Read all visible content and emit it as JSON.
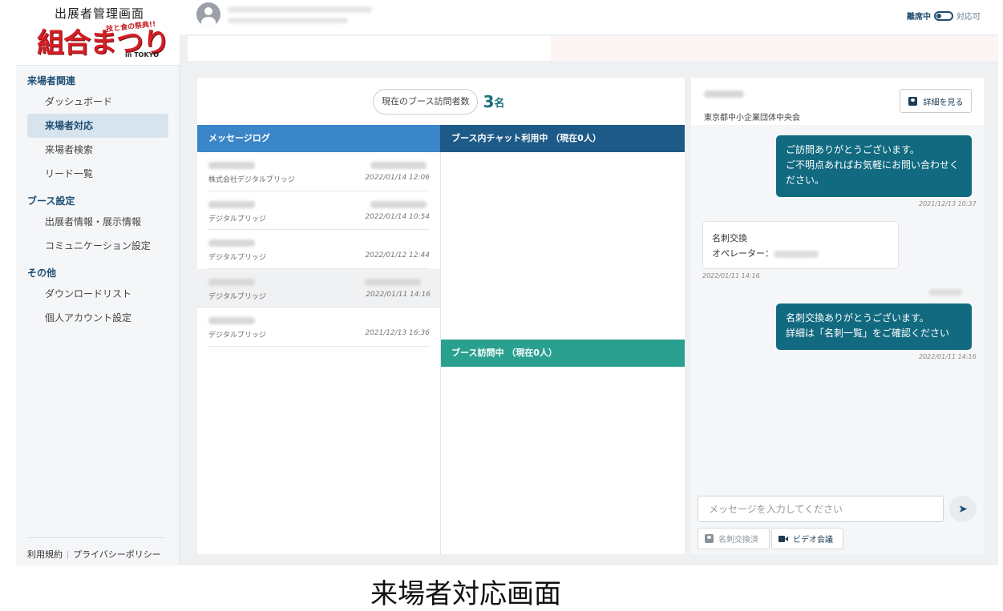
{
  "logo": {
    "title": "出展者管理画面",
    "main": "組合まつり",
    "sub": "技と食の祭典!!",
    "location": "in TOKYO"
  },
  "sidebar": {
    "sections": [
      {
        "label": "来場者関連",
        "items": [
          "ダッシュボード",
          "来場者対応",
          "来場者検索",
          "リード一覧"
        ]
      },
      {
        "label": "ブース設定",
        "items": [
          "出展者情報・展示情報",
          "コミュニケーション設定"
        ]
      },
      {
        "label": "その他",
        "items": [
          "ダウンロードリスト",
          "個人アカウント設定"
        ]
      }
    ],
    "active_item": "来場者対応",
    "footer": {
      "terms": "利用規約",
      "privacy": "プライバシーポリシー"
    }
  },
  "header": {
    "status_away": "離席中",
    "status_available": "対応可"
  },
  "visitors": {
    "label": "現在のブース訪問者数",
    "count": "3",
    "unit": "名"
  },
  "columns": {
    "message_log": "メッセージログ",
    "chat_in_booth": "ブース内チャット利用中 （現在0人）",
    "visiting_booth": "ブース訪問中 （現在0人）"
  },
  "message_log": [
    {
      "company": "株式会社デジタルブリッジ",
      "time": "2022/01/14 12:06",
      "selected": false
    },
    {
      "company": "デジタルブリッジ",
      "time": "2022/01/14 10:54",
      "selected": false
    },
    {
      "company": "デジタルブリッジ",
      "time": "2022/01/12 12:44",
      "selected": false
    },
    {
      "company": "デジタルブリッジ",
      "time": "2022/01/11 14:16",
      "selected": true
    },
    {
      "company": "デジタルブリッジ",
      "time": "2021/12/13 16:36",
      "selected": false
    }
  ],
  "chat": {
    "organization": "東京都中小企業団体中央会",
    "detail_button": "詳細を見る",
    "messages": [
      {
        "from": "operator",
        "lines": [
          "ご訪問ありがとうございます。",
          "ご不明点あればお気軽にお問い合わせく",
          "ださい。"
        ],
        "time": "2021/12/13 10:37"
      },
      {
        "from": "visitor",
        "lines": [
          "名刺交換",
          "オペレーター："
        ],
        "time": "2022/01/11 14:16"
      },
      {
        "from": "operator",
        "lines": [
          "名刺交換ありがとうございます。",
          "詳細は「名刺一覧」をご確認ください"
        ],
        "time": "2022/01/11 14:16"
      }
    ],
    "input_placeholder": "メッセージを入力してください",
    "card_exchanged_button": "名刺交換済",
    "video_button": "ビデオ会議"
  },
  "caption": "来場者対応画面"
}
